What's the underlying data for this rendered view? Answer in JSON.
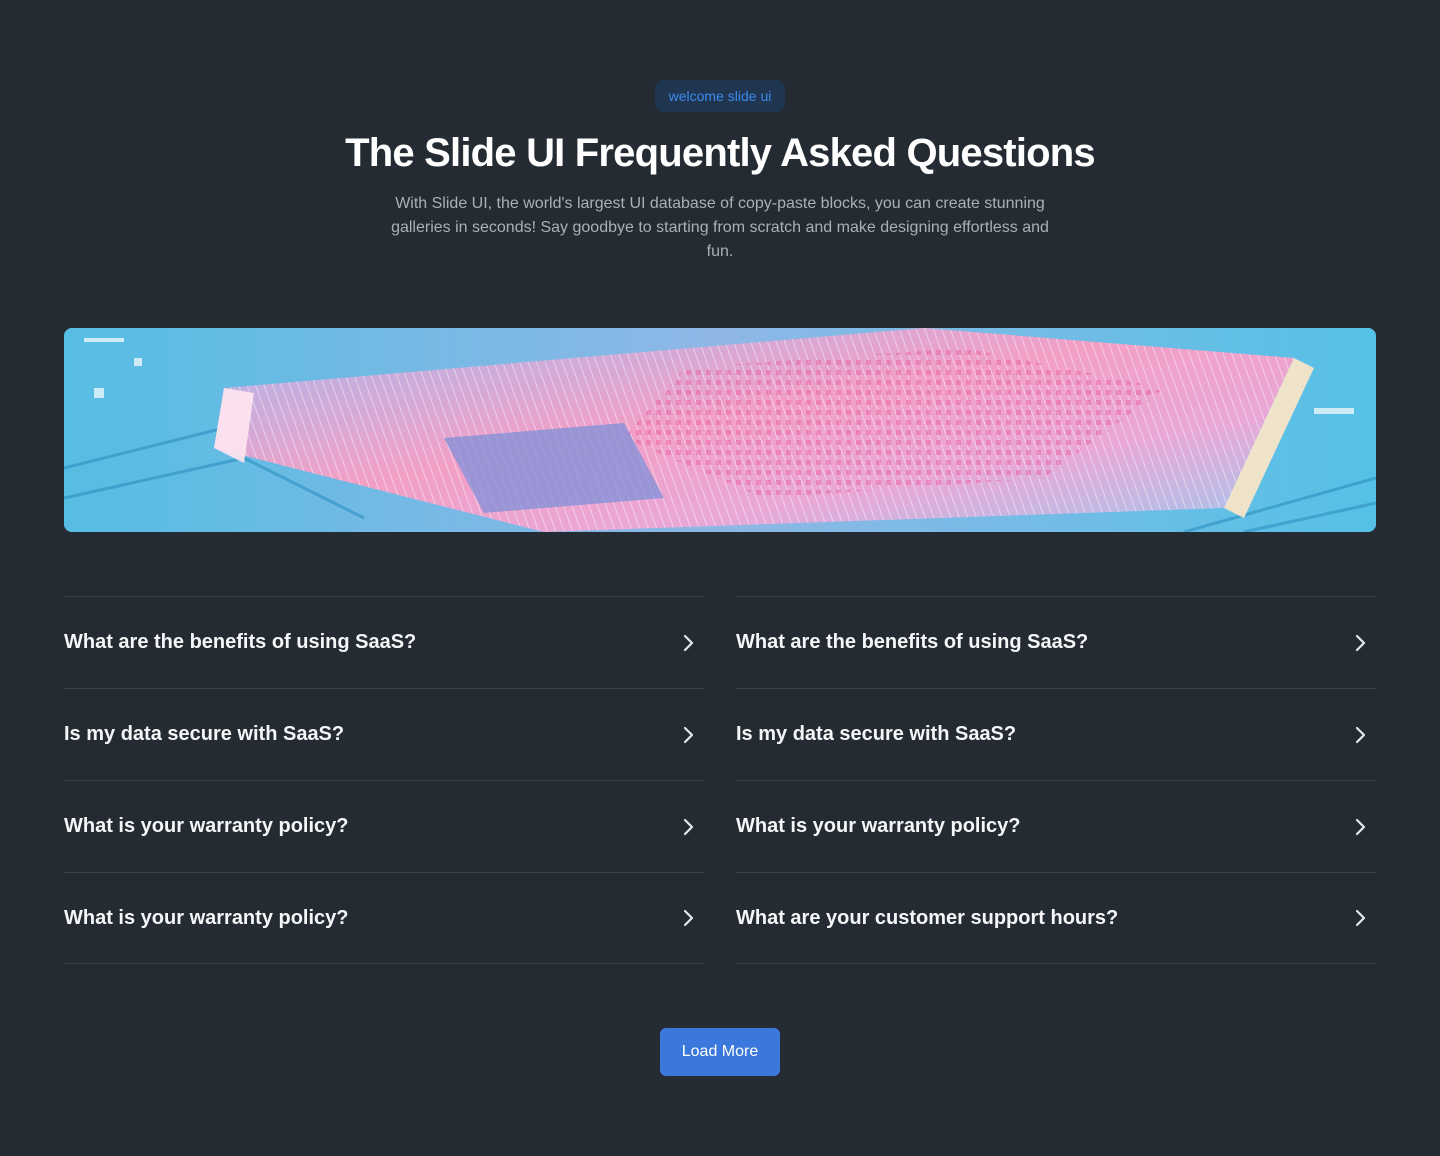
{
  "badge": "welcome slide ui",
  "title": "The Slide UI Frequently Asked Questions",
  "subtitle": "With Slide UI, the world's largest UI database of copy-paste blocks, you can create stunning galleries in seconds! Say goodbye to starting from scratch and make designing effortless and fun.",
  "hero": {
    "icon": "circuit-illustration"
  },
  "faq": {
    "left": [
      "What are the benefits of using SaaS?",
      "Is my data secure with SaaS?",
      "What is your warranty policy?",
      "What is your warranty policy?"
    ],
    "right": [
      "What are the benefits of using SaaS?",
      "Is my data secure with SaaS?",
      "What is your warranty policy?",
      "What are your customer support hours?"
    ],
    "chevron_icon": "chevron-right-icon"
  },
  "load_more": "Load More",
  "colors": {
    "background": "#252b32",
    "accent": "#3a78db",
    "badge_text": "#3d8bf0"
  }
}
